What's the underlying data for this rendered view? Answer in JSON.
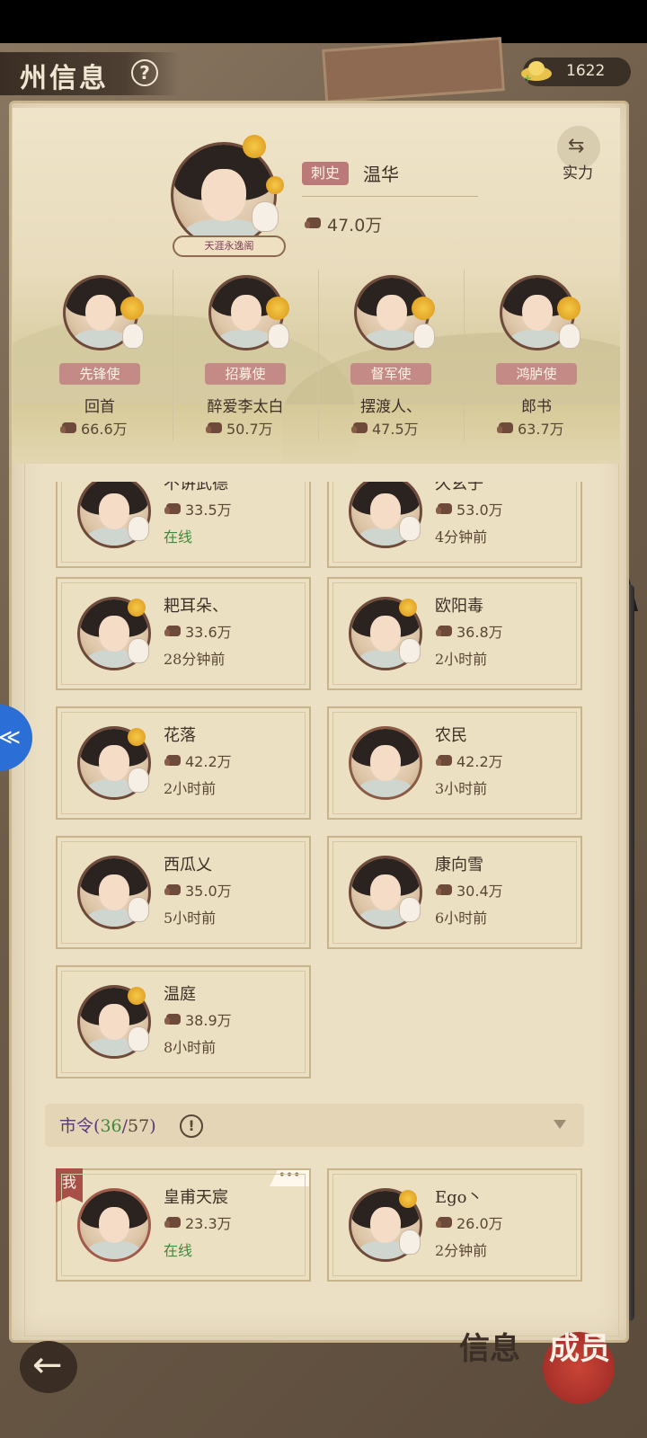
{
  "header": {
    "title": "州信息",
    "help_icon": "?",
    "currency_value": "1622"
  },
  "leader": {
    "role": "刺史",
    "name": "温华",
    "power": "47.0万",
    "badge": "天涯永逸阁"
  },
  "switch": {
    "label": "实力",
    "icon": "⇆"
  },
  "officers": [
    {
      "role": "先锋使",
      "name": "回首",
      "power": "66.6万"
    },
    {
      "role": "招募使",
      "name": "醉爱李太白",
      "power": "50.7万"
    },
    {
      "role": "督军使",
      "name": "摆渡人、",
      "power": "47.5万"
    },
    {
      "role": "鸿胪使",
      "name": "郎书",
      "power": "63.7万"
    }
  ],
  "members": [
    {
      "name": "不讲武德",
      "power": "33.5万",
      "status": "在线",
      "online": true
    },
    {
      "name": "久玄子",
      "power": "53.0万",
      "status": "4分钟前",
      "online": false
    },
    {
      "name": "耙耳朵、",
      "power": "33.6万",
      "status": "28分钟前",
      "online": false
    },
    {
      "name": "欧阳毒",
      "power": "36.8万",
      "status": "2小时前",
      "online": false
    },
    {
      "name": "花落",
      "power": "42.2万",
      "status": "2小时前",
      "online": false
    },
    {
      "name": "农民",
      "power": "42.2万",
      "status": "3小时前",
      "online": false
    },
    {
      "name": "西瓜乂",
      "power": "35.0万",
      "status": "5小时前",
      "online": false
    },
    {
      "name": "康向雪",
      "power": "30.4万",
      "status": "6小时前",
      "online": false
    },
    {
      "name": "温庭",
      "power": "38.9万",
      "status": "8小时前",
      "online": false
    }
  ],
  "section": {
    "label": "市令",
    "current": "36",
    "total": "57",
    "info_icon": "!"
  },
  "city_members": [
    {
      "name": "皇甫天宸",
      "power": "23.3万",
      "status": "在线",
      "online": true,
      "me_tag": "我",
      "more": "•••"
    },
    {
      "name": "Ego丶",
      "power": "26.0万",
      "status": "2分钟前",
      "online": false
    }
  ],
  "bottom": {
    "back_icon": "←",
    "tab_info": "信息",
    "tab_members": "成员"
  },
  "side_float_icon": "≪",
  "colors": {
    "accent_role": "#b97a78",
    "online": "#3f8a3c",
    "seal": "#a7302a"
  }
}
